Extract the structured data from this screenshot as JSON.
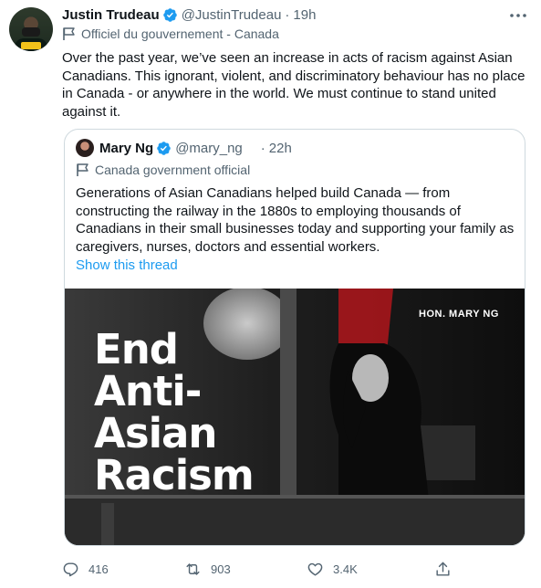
{
  "tweet": {
    "author_name": "Justin Trudeau",
    "handle": "@JustinTrudeau",
    "separator": "·",
    "time": "19h",
    "label": "Officiel du gouvernement - Canada",
    "text": "Over the past year, we’ve seen an increase in acts of racism against Asian Canadians. This ignorant, violent, and discriminatory behaviour has no place in Canada - or anywhere in the world. We must continue to stand united against it."
  },
  "quote": {
    "author_name": "Mary Ng",
    "handle": "@mary_ng",
    "separator": "·",
    "time": "22h",
    "label": "Canada government official",
    "text": "Generations of Asian Canadians helped build Canada — from constructing the railway in the 1880s to employing thousands of Canadians in their small businesses today and supporting your family as caregivers, nurses, doctors and essential workers.",
    "show_thread": "Show this thread",
    "image": {
      "title_lines": [
        "End",
        "Anti-",
        "Asian",
        "Racism"
      ],
      "caption": "HON. MARY NG"
    }
  },
  "actions": {
    "reply_count": "416",
    "retweet_count": "903",
    "like_count": "3.4K",
    "share_count": ""
  },
  "colors": {
    "verified_blue": "#1d9bf0",
    "link_blue": "#1d9bf0",
    "muted_text": "#536471",
    "flag_red": "#c4161c"
  },
  "icons": [
    "verified-badge-icon",
    "more-icon",
    "flag-icon",
    "reply-icon",
    "retweet-icon",
    "like-icon",
    "share-icon"
  ]
}
